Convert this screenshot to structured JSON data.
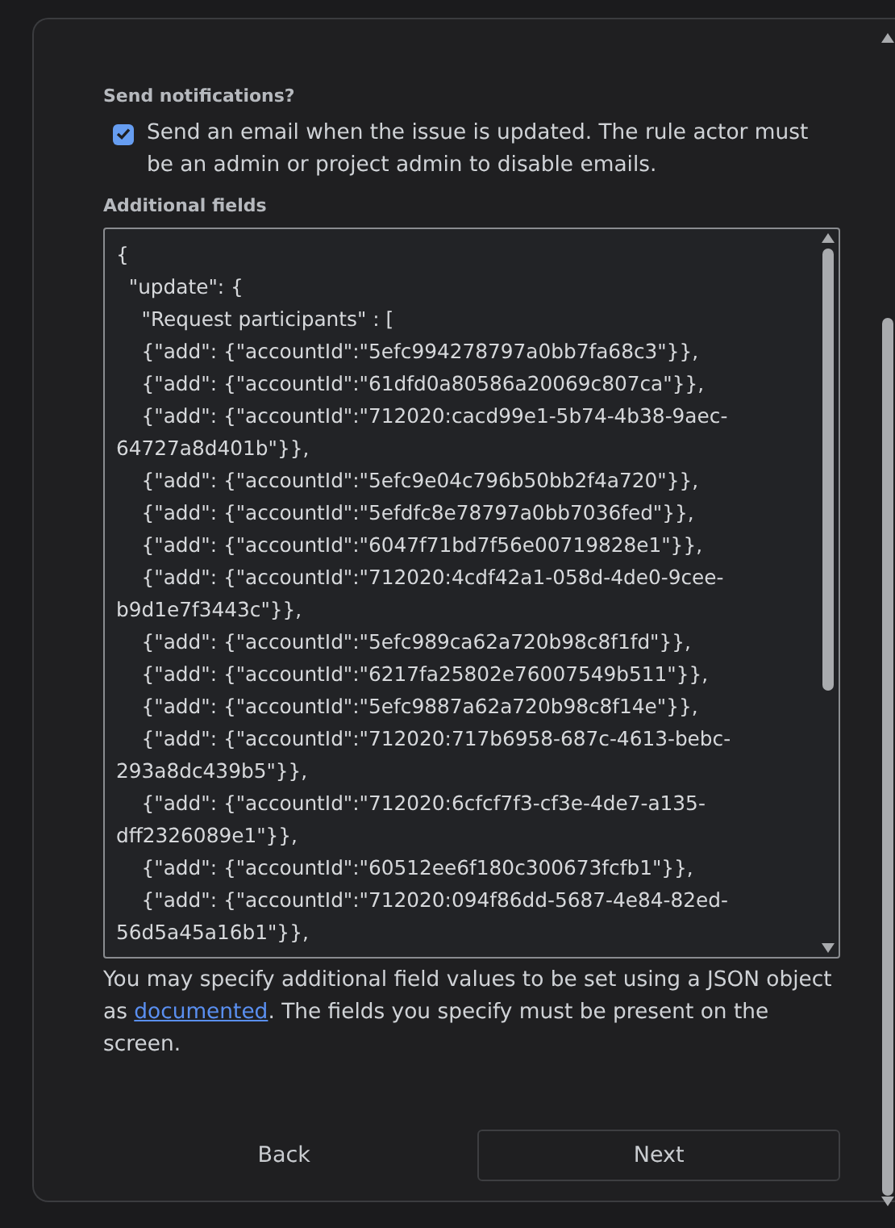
{
  "notifications": {
    "label": "Send notifications?",
    "checkbox": {
      "label": "Send an email when the issue is updated. The rule actor must be an admin or project admin to disable emails.",
      "checked": true
    }
  },
  "additional_fields": {
    "label": "Additional fields",
    "value_lines": [
      "{",
      "  \"update\": {",
      "    \"Request participants\" : [",
      "    {\"add\": {\"accountId\":\"5efc994278797a0bb7fa68c3\"}},",
      "    {\"add\": {\"accountId\":\"61dfd0a80586a20069c807ca\"}},",
      "    {\"add\": {\"accountId\":\"712020:cacd99e1-5b74-4b38-9aec-",
      "64727a8d401b\"}},",
      "    {\"add\": {\"accountId\":\"5efc9e04c796b50bb2f4a720\"}},",
      "    {\"add\": {\"accountId\":\"5efdfc8e78797a0bb7036fed\"}},",
      "    {\"add\": {\"accountId\":\"6047f71bd7f56e00719828e1\"}},",
      "    {\"add\": {\"accountId\":\"712020:4cdf42a1-058d-4de0-9cee-",
      "b9d1e7f3443c\"}},",
      "    {\"add\": {\"accountId\":\"5efc989ca62a720b98c8f1fd\"}},",
      "    {\"add\": {\"accountId\":\"6217fa25802e76007549b511\"}},",
      "    {\"add\": {\"accountId\":\"5efc9887a62a720b98c8f14e\"}},",
      "    {\"add\": {\"accountId\":\"712020:717b6958-687c-4613-bebc-",
      "293a8dc439b5\"}},",
      "    {\"add\": {\"accountId\":\"712020:6cfcf7f3-cf3e-4de7-a135-",
      "dff2326089e1\"}},",
      "    {\"add\": {\"accountId\":\"60512ee6f180c300673fcfb1\"}},",
      "    {\"add\": {\"accountId\":\"712020:094f86dd-5687-4e84-82ed-",
      "56d5a45a16b1\"}},"
    ],
    "help_before": "You may specify additional field values to be set using a JSON object as ",
    "help_link": "documented",
    "help_after": ". The fields you specify must be present on the screen."
  },
  "buttons": [
    {
      "label": "Back",
      "kind": "subtle"
    },
    {
      "label": "Next",
      "kind": "outline"
    }
  ]
}
